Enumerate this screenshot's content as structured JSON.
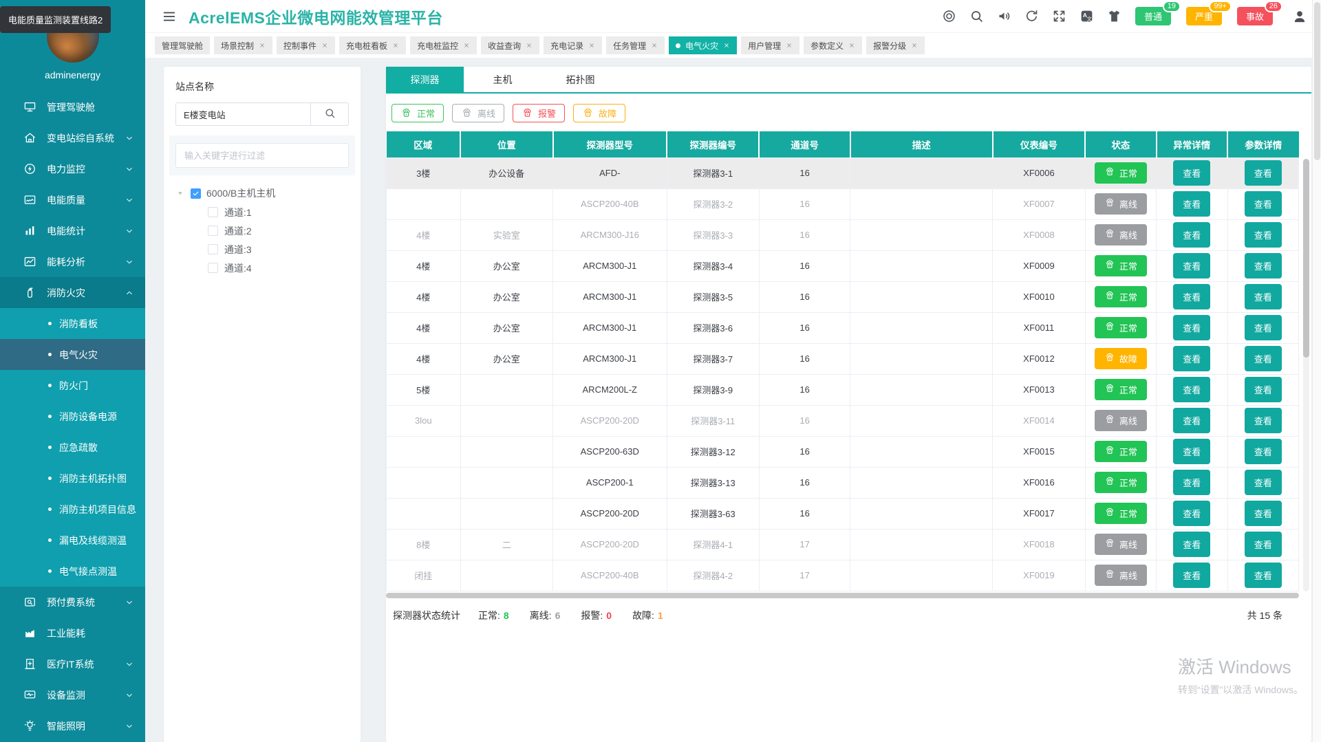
{
  "tooltip": {
    "text": "电能质量监测装置线路2"
  },
  "header": {
    "title": "AcrelEMS企业微电网能效管理平台",
    "icons": [
      {
        "name": "aim-icon",
        "glyph": "aim"
      },
      {
        "name": "search-icon",
        "glyph": "search"
      },
      {
        "name": "speaker-icon",
        "glyph": "speaker"
      },
      {
        "name": "refresh-icon",
        "glyph": "refresh"
      },
      {
        "name": "fullscreen-icon",
        "glyph": "fullscreen"
      },
      {
        "name": "translate-icon",
        "glyph": "translate"
      },
      {
        "name": "theme-icon",
        "glyph": "theme"
      }
    ],
    "alarms": [
      {
        "label": "普通",
        "count": "19",
        "color": "#2ec573"
      },
      {
        "label": "严重",
        "count": "99+",
        "color": "#ffb400"
      },
      {
        "label": "事故",
        "count": "26",
        "color": "#f4515c"
      }
    ]
  },
  "tabs": [
    {
      "label": "管理驾驶舱",
      "closable": false,
      "active": false
    },
    {
      "label": "场景控制",
      "closable": true,
      "active": false
    },
    {
      "label": "控制事件",
      "closable": true,
      "active": false
    },
    {
      "label": "充电桩看板",
      "closable": true,
      "active": false
    },
    {
      "label": "充电桩监控",
      "closable": true,
      "active": false
    },
    {
      "label": "收益查询",
      "closable": true,
      "active": false
    },
    {
      "label": "充电记录",
      "closable": true,
      "active": false
    },
    {
      "label": "任务管理",
      "closable": true,
      "active": false
    },
    {
      "label": "电气火灾",
      "closable": true,
      "active": true
    },
    {
      "label": "用户管理",
      "closable": true,
      "active": false
    },
    {
      "label": "参数定义",
      "closable": true,
      "active": false
    },
    {
      "label": "报警分级",
      "closable": true,
      "active": false
    }
  ],
  "sidebar": {
    "username": "adminenergy",
    "items": [
      {
        "label": "管理驾驶舱",
        "icon": "dashboard-icon",
        "chevron": false
      },
      {
        "label": "变电站综自系统",
        "icon": "substation-icon",
        "chevron": true
      },
      {
        "label": "电力监控",
        "icon": "power-monitor-icon",
        "chevron": true
      },
      {
        "label": "电能质量",
        "icon": "power-quality-icon",
        "chevron": true
      },
      {
        "label": "电能统计",
        "icon": "energy-stats-icon",
        "chevron": true
      },
      {
        "label": "能耗分析",
        "icon": "energy-analysis-icon",
        "chevron": true
      },
      {
        "label": "消防火灾",
        "icon": "fire-icon",
        "chevron": true,
        "expanded": true,
        "children": [
          {
            "label": "消防看板",
            "active": false
          },
          {
            "label": "电气火灾",
            "active": true
          },
          {
            "label": "防火门",
            "active": false
          },
          {
            "label": "消防设备电源",
            "active": false
          },
          {
            "label": "应急疏散",
            "active": false
          },
          {
            "label": "消防主机拓扑图",
            "active": false
          },
          {
            "label": "消防主机项目信息",
            "active": false
          },
          {
            "label": "漏电及线缆测温",
            "active": false
          },
          {
            "label": "电气接点测温",
            "active": false
          }
        ]
      },
      {
        "label": "预付费系统",
        "icon": "prepaid-icon",
        "chevron": true
      },
      {
        "label": "工业能耗",
        "icon": "industry-icon",
        "chevron": false
      },
      {
        "label": "医疗IT系统",
        "icon": "medical-icon",
        "chevron": true
      },
      {
        "label": "设备监测",
        "icon": "device-monitor-icon",
        "chevron": true
      },
      {
        "label": "智能照明",
        "icon": "lighting-icon",
        "chevron": true
      }
    ]
  },
  "station": {
    "title": "站点名称",
    "search_value": "E楼变电站",
    "filter_placeholder": "输入关键字进行过滤",
    "tree": {
      "label": "6000/B主机主机",
      "checked": true,
      "children": [
        {
          "label": "通道:1",
          "checked": false
        },
        {
          "label": "通道:2",
          "checked": false
        },
        {
          "label": "通道:3",
          "checked": false
        },
        {
          "label": "通道:4",
          "checked": false
        }
      ]
    }
  },
  "main": {
    "tabs": [
      {
        "label": "探测器",
        "active": true
      },
      {
        "label": "主机",
        "active": false
      },
      {
        "label": "拓扑图",
        "active": false
      }
    ],
    "filters": [
      {
        "label": "正常",
        "color": "#3ec25e"
      },
      {
        "label": "离线",
        "color": "#a7adb2"
      },
      {
        "label": "报警",
        "color": "#f45156"
      },
      {
        "label": "故障",
        "color": "#fbb017"
      }
    ],
    "table": {
      "columns": [
        "区域",
        "位置",
        "探测器型号",
        "探测器编号",
        "通道号",
        "描述",
        "仪表编号",
        "状态",
        "异常详情",
        "参数详情"
      ],
      "view_label": "查看",
      "rows": [
        {
          "area": "3楼",
          "location": "办公设备",
          "model": "AFD-",
          "detector": "探测器3-1",
          "channel": "16",
          "desc": "",
          "meter": "XF0006",
          "status": {
            "type": "normal",
            "label": "正常"
          }
        },
        {
          "area": "",
          "location": "",
          "model": "ASCP200-40B",
          "detector": "探测器3-2",
          "channel": "16",
          "desc": "",
          "meter": "XF0007",
          "status": {
            "type": "offline",
            "label": "离线"
          }
        },
        {
          "area": "4楼",
          "location": "实验室",
          "model": "ARCM300-J16",
          "detector": "探测器3-3",
          "channel": "16",
          "desc": "",
          "meter": "XF0008",
          "status": {
            "type": "offline",
            "label": "离线"
          }
        },
        {
          "area": "4楼",
          "location": "办公室",
          "model": "ARCM300-J1",
          "detector": "探测器3-4",
          "channel": "16",
          "desc": "",
          "meter": "XF0009",
          "status": {
            "type": "normal",
            "label": "正常"
          }
        },
        {
          "area": "4楼",
          "location": "办公室",
          "model": "ARCM300-J1",
          "detector": "探测器3-5",
          "channel": "16",
          "desc": "",
          "meter": "XF0010",
          "status": {
            "type": "normal",
            "label": "正常"
          }
        },
        {
          "area": "4楼",
          "location": "办公室",
          "model": "ARCM300-J1",
          "detector": "探测器3-6",
          "channel": "16",
          "desc": "",
          "meter": "XF0011",
          "status": {
            "type": "normal",
            "label": "正常"
          }
        },
        {
          "area": "4楼",
          "location": "办公室",
          "model": "ARCM300-J1",
          "detector": "探测器3-7",
          "channel": "16",
          "desc": "",
          "meter": "XF0012",
          "status": {
            "type": "fault",
            "label": "故障"
          }
        },
        {
          "area": "5楼",
          "location": "",
          "model": "ARCM200L-Z",
          "detector": "探测器3-9",
          "channel": "16",
          "desc": "",
          "meter": "XF0013",
          "status": {
            "type": "normal",
            "label": "正常"
          }
        },
        {
          "area": "3lou",
          "location": "",
          "model": "ASCP200-20D",
          "detector": "探测器3-11",
          "channel": "16",
          "desc": "",
          "meter": "XF0014",
          "status": {
            "type": "offline",
            "label": "离线"
          }
        },
        {
          "area": "",
          "location": "",
          "model": "ASCP200-63D",
          "detector": "探测器3-12",
          "channel": "16",
          "desc": "",
          "meter": "XF0015",
          "status": {
            "type": "normal",
            "label": "正常"
          }
        },
        {
          "area": "",
          "location": "",
          "model": "ASCP200-1",
          "detector": "探测器3-13",
          "channel": "16",
          "desc": "",
          "meter": "XF0016",
          "status": {
            "type": "normal",
            "label": "正常"
          }
        },
        {
          "area": "",
          "location": "",
          "model": "ASCP200-20D",
          "detector": "探测器3-63",
          "channel": "16",
          "desc": "",
          "meter": "XF0017",
          "status": {
            "type": "normal",
            "label": "正常"
          }
        },
        {
          "area": "8楼",
          "location": "二",
          "model": "ASCP200-20D",
          "detector": "探测器4-1",
          "channel": "17",
          "desc": "",
          "meter": "XF0018",
          "status": {
            "type": "offline",
            "label": "离线"
          }
        },
        {
          "area": "闭挂",
          "location": "",
          "model": "ASCP200-40B",
          "detector": "探测器4-2",
          "channel": "17",
          "desc": "",
          "meter": "XF0019",
          "status": {
            "type": "offline",
            "label": "离线"
          }
        }
      ]
    },
    "stats": {
      "title": "探测器状态统计",
      "items": [
        {
          "label": "正常:",
          "value": "8",
          "color": "#21c651"
        },
        {
          "label": "离线:",
          "value": "6",
          "color": "#9aa0a6"
        },
        {
          "label": "报警:",
          "value": "0",
          "color": "#f4434b"
        },
        {
          "label": "故障:",
          "value": "1",
          "color": "#ff9e44"
        }
      ],
      "total": "共 15 条"
    }
  },
  "watermark": {
    "line1": "激活 Windows",
    "line2": "转到“设置”以激活 Windows。"
  }
}
